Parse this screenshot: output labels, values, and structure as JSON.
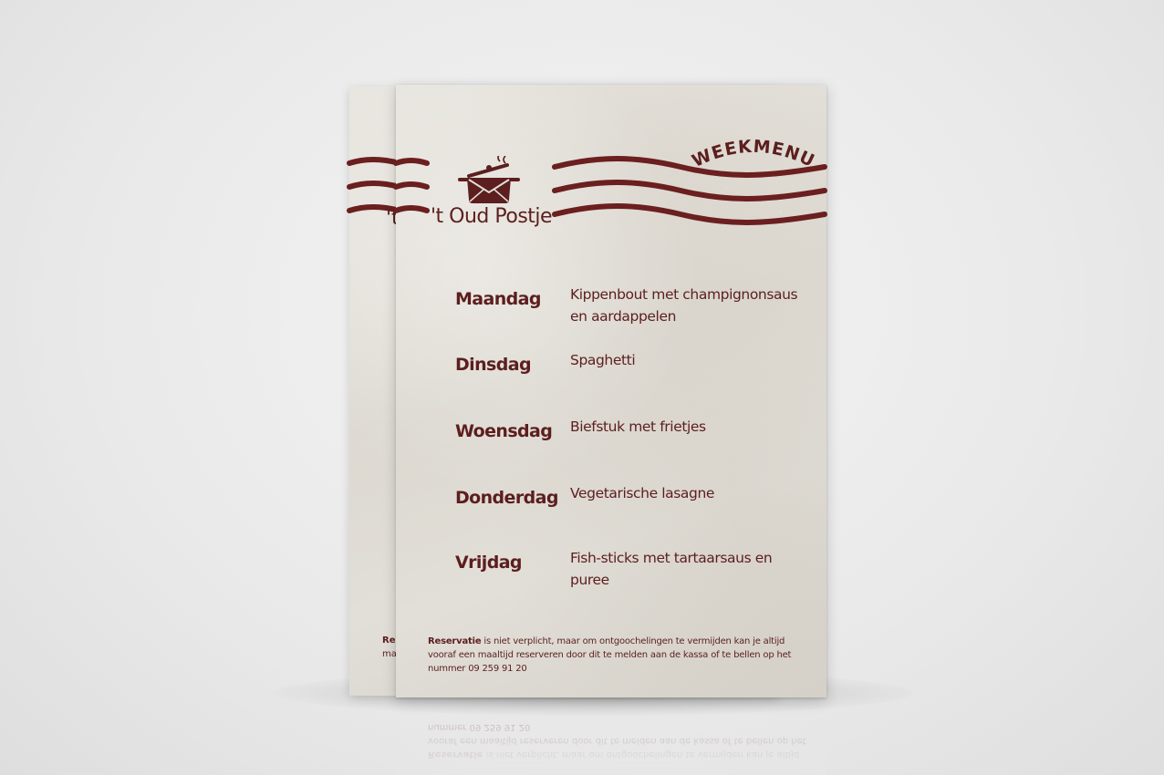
{
  "brand": {
    "name": "'t Oud Postje",
    "name_back_fragment": "'t"
  },
  "heading": "WEEKMENU",
  "menu": [
    {
      "day": "Maandag",
      "dish": "Kippenbout met champignonsaus en aardappelen"
    },
    {
      "day": "Dinsdag",
      "dish": "Spaghetti"
    },
    {
      "day": "Woensdag",
      "dish": "Biefstuk met frietjes"
    },
    {
      "day": "Donderdag",
      "dish": "Vegetarische lasagne"
    },
    {
      "day": "Vrijdag",
      "dish": "Fish-sticks met tartaarsaus en puree"
    }
  ],
  "footer": {
    "lead": "Reservatie",
    "text": " is niet verplicht, maar om ontgoochelingen te vermijden kan je altijd vooraf een maaltijd reserveren door dit te melden aan de kassa of te bellen op het nummer 09 259 91 20"
  },
  "back_sheet": {
    "footer_line1": "Res",
    "footer_line2": "maa"
  },
  "colors": {
    "brand": "#5c1e1e",
    "paper": "#e2dfd8"
  },
  "icons": {
    "logo": "cooking-pot-envelope-icon"
  }
}
